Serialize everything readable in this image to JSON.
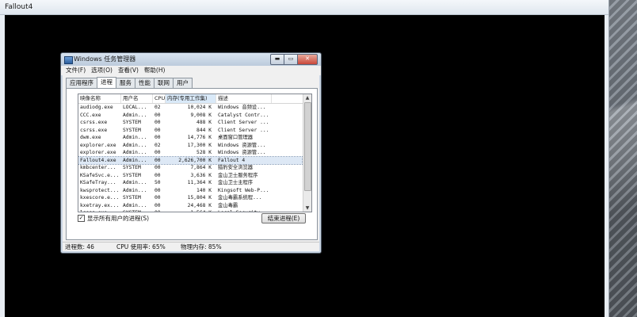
{
  "game_window": {
    "title": "Fallout4"
  },
  "task_manager": {
    "title": "Windows 任务管理器",
    "window_buttons": {
      "minimize": "▬",
      "maximize": "▭",
      "close": "✕"
    },
    "menu": [
      "文件(F)",
      "选项(O)",
      "查看(V)",
      "帮助(H)"
    ],
    "tabs": [
      "应用程序",
      "进程",
      "服务",
      "性能",
      "联网",
      "用户"
    ],
    "active_tab": "进程",
    "columns": [
      "映像名称",
      "用户名",
      "CPU",
      "内存(专用工作集)",
      "描述"
    ],
    "processes": [
      [
        "audiodg.exe",
        "LOCAL...",
        "02",
        "10,024 K",
        "Windows 音频设..."
      ],
      [
        "CCC.exe",
        "Admin...",
        "00",
        "9,008 K",
        "Catalyst Contr..."
      ],
      [
        "csrss.exe",
        "SYSTEM",
        "00",
        "488 K",
        "Client Server ..."
      ],
      [
        "csrss.exe",
        "SYSTEM",
        "00",
        "844 K",
        "Client Server ..."
      ],
      [
        "dwm.exe",
        "Admin...",
        "00",
        "14,776 K",
        "桌面窗口管理器"
      ],
      [
        "explorer.exe",
        "Admin...",
        "02",
        "17,300 K",
        "Windows 资源管..."
      ],
      [
        "explorer.exe",
        "Admin...",
        "00",
        "528 K",
        "Windows 资源管..."
      ],
      [
        "Fallout4.exe",
        "Admin...",
        "00",
        "2,626,700 K",
        "Fallout 4"
      ],
      [
        "kmbcenter...",
        "SYSTEM",
        "00",
        "7,864 K",
        "猎豹安全浏览器"
      ],
      [
        "KSafeSvc.e...",
        "SYSTEM",
        "00",
        "3,636 K",
        "金山卫士服务程序"
      ],
      [
        "KSafeTray...",
        "Admin...",
        "50",
        "11,364 K",
        "金山卫士主程序"
      ],
      [
        "kwsprotect...",
        "Admin...",
        "00",
        "140 K",
        "Kingsoft Web-P..."
      ],
      [
        "kxescore.e...",
        "SYSTEM",
        "00",
        "15,804 K",
        "金山毒霸系统程..."
      ],
      [
        "kxetray.ex...",
        "Admin...",
        "00",
        "24,468 K",
        "金山毒霸"
      ],
      [
        "lsass.exe",
        "SYSTEM",
        "00",
        "1,564 K",
        "Local Security..."
      ]
    ],
    "selected_process": "Fallout4.exe",
    "show_all_label": "显示所有用户的进程(S)",
    "end_process_label": "结束进程(E)",
    "status": {
      "processes": "进程数: 46",
      "cpu": "CPU 使用率: 65%",
      "memory": "物理内存: 85%"
    }
  }
}
